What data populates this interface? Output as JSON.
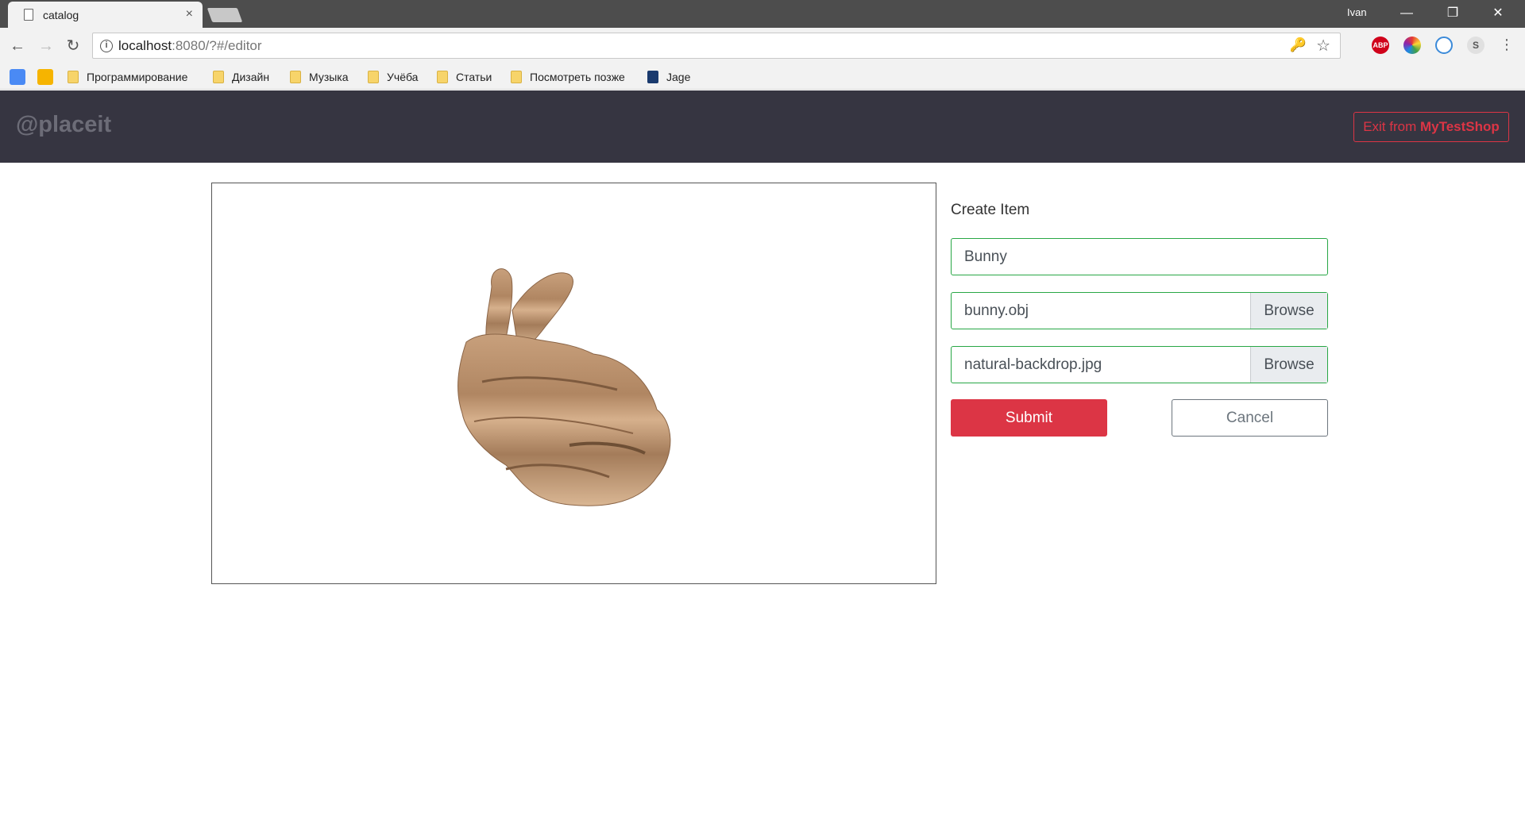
{
  "browser": {
    "tab_title": "catalog",
    "tab_close": "×",
    "user": "Ivan",
    "url_host": "localhost",
    "url_rest": ":8080/?#/editor",
    "extensions": [
      "ABP",
      "",
      "",
      "S"
    ]
  },
  "bookmarks": [
    {
      "label": "Программирование",
      "icon": "folder-icon"
    },
    {
      "label": "Дизайн",
      "icon": "folder-icon"
    },
    {
      "label": "Музыка",
      "icon": "folder-icon"
    },
    {
      "label": "Учёба",
      "icon": "folder-icon"
    },
    {
      "label": "Статьи",
      "icon": "folder-icon"
    },
    {
      "label": "Посмотреть позже",
      "icon": "folder-icon"
    },
    {
      "label": "Jage",
      "icon": "app-icon"
    }
  ],
  "app": {
    "brand": "@placeit",
    "exit_prefix": "Exit from ",
    "exit_shop": "MyTestShop",
    "accent": "#dc3545",
    "success": "#28a745"
  },
  "form": {
    "title": "Create Item",
    "name_value": "Bunny",
    "model_file": "bunny.obj",
    "texture_file": "natural-backdrop.jpg",
    "browse_label": "Browse",
    "submit_label": "Submit",
    "cancel_label": "Cancel"
  },
  "viewer": {
    "model": "bunny-3d-model"
  }
}
